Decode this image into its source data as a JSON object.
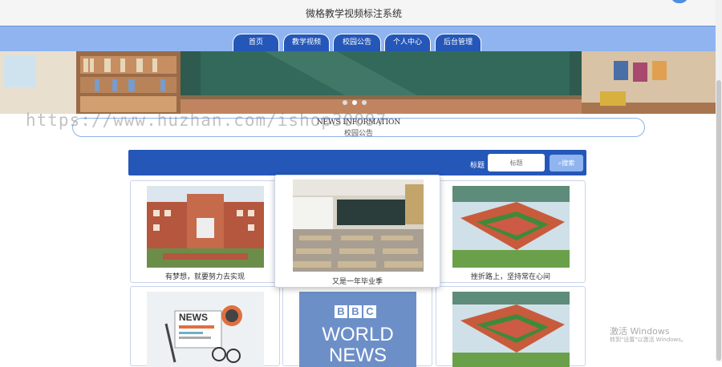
{
  "header": {
    "title": "微格教学视频标注系统"
  },
  "nav": {
    "items": [
      "首页",
      "教学视频",
      "校园公告",
      "个人中心",
      "后台管理"
    ]
  },
  "section": {
    "title_en": "NEWS INFORMATION",
    "title_cn": "校园公告"
  },
  "watermark": "https://www.huzhan.com/ishop30097",
  "search": {
    "label": "标题",
    "placeholder": "标题",
    "button": "搜索"
  },
  "cards": [
    {
      "caption": "有梦想，就要努力去实现"
    },
    {
      "caption": "又是一年毕业季"
    },
    {
      "caption": "挫折路上，坚持常在心间"
    },
    {
      "caption": ""
    },
    {
      "caption": ""
    },
    {
      "caption": ""
    }
  ],
  "card_images": {
    "news_word": "NEWS",
    "bbc": [
      "B",
      "B",
      "C"
    ],
    "bbc_line1": "WORLD",
    "bbc_line2": "NEWS"
  },
  "windows": {
    "line1": "激活 Windows",
    "line2": "转到\"设置\"以激活 Windows。"
  },
  "colors": {
    "primary": "#2457b8",
    "light": "#8fb4f0"
  }
}
